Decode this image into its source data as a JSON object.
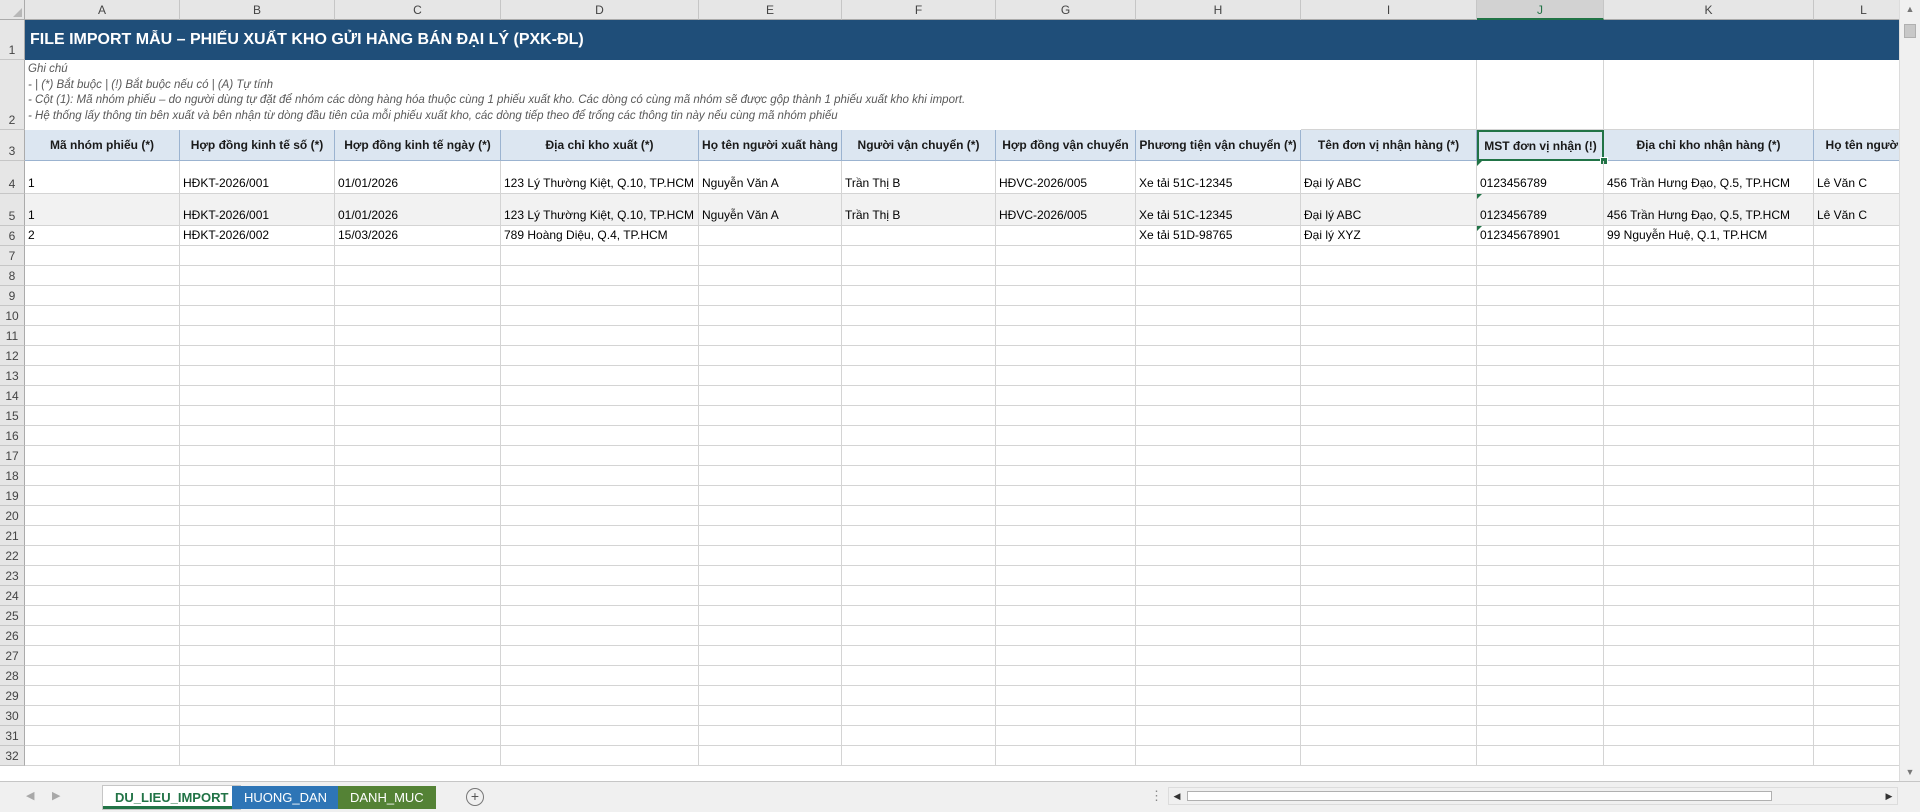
{
  "columns": [
    "A",
    "B",
    "C",
    "D",
    "E",
    "F",
    "G",
    "H",
    "I",
    "J",
    "K",
    "L"
  ],
  "active_column": "J",
  "rows": [
    "1",
    "2",
    "3",
    "4",
    "5",
    "6",
    "7",
    "8",
    "9",
    "10",
    "11",
    "12",
    "13",
    "14",
    "15",
    "16",
    "17",
    "18",
    "19",
    "20",
    "21",
    "22",
    "23",
    "24",
    "25",
    "26",
    "27",
    "28",
    "29",
    "30",
    "31",
    "32"
  ],
  "title": "FILE IMPORT MẪU – PHIẾU XUẤT KHO GỬI HÀNG BÁN ĐẠI LÝ (PXK-ĐL)",
  "notes": [
    "Ghi chú",
    "- |  (*) Bắt buộc  |  (!) Bắt buộc nếu có  |  (A) Tự tính",
    "- Cột (1): Mã nhóm phiếu – do người dùng tự đặt để nhóm các dòng hàng hóa thuộc cùng 1 phiếu xuất kho. Các dòng có cùng mã nhóm sẽ được gộp thành 1 phiếu xuất kho khi import.",
    "- Hệ thống lấy thông tin bên xuất và bên nhận từ dòng đầu tiên của mỗi phiếu xuất kho, các dòng tiếp theo để trống các thông tin này nếu cùng mã nhóm phiếu"
  ],
  "headers": [
    "Mã nhóm phiếu (*)",
    "Hợp đồng kinh tế số (*)",
    "Hợp đồng kinh tế ngày (*)",
    "Địa chỉ kho xuất (*)",
    "Họ tên người xuất hàng",
    "Người vận chuyển (*)",
    "Hợp đồng vận chuyển",
    "Phương tiện vận chuyển (*)",
    "Tên đơn vị nhận hàng (*)",
    "MST đơn vị nhận (!)",
    "Địa chỉ kho nhận hàng (*)",
    "Họ tên người"
  ],
  "data_rows": [
    [
      "1",
      "HĐKT-2026/001",
      "01/01/2026",
      "123 Lý Thường Kiệt, Q.10, TP.HCM",
      "Nguyễn Văn A",
      "Trần Thị B",
      "HĐVC-2026/005",
      "Xe tải 51C-12345",
      "Đại lý ABC",
      "0123456789",
      "456 Trần Hưng Đạo, Q.5, TP.HCM",
      "Lê Văn C"
    ],
    [
      "1",
      "HĐKT-2026/001",
      "01/01/2026",
      "123 Lý Thường Kiệt, Q.10, TP.HCM",
      "Nguyễn Văn A",
      "Trần Thị B",
      "HĐVC-2026/005",
      "Xe tải 51C-12345",
      "Đại lý ABC",
      "0123456789",
      "456 Trần Hưng Đạo, Q.5, TP.HCM",
      "Lê Văn C"
    ],
    [
      "2",
      "HĐKT-2026/002",
      "15/03/2026",
      "789 Hoàng Diệu, Q.4, TP.HCM",
      "",
      "",
      "",
      "Xe tải 51D-98765",
      "Đại lý XYZ",
      "012345678901",
      "99 Nguyễn Huệ, Q.1, TP.HCM",
      ""
    ]
  ],
  "sheet_tabs": [
    {
      "label": "DU_LIEU_IMPORT",
      "style": "active"
    },
    {
      "label": "HUONG_DAN",
      "style": "blue"
    },
    {
      "label": "DANH_MUC",
      "style": "green"
    }
  ],
  "colors": {
    "title_band": "#1f4e79",
    "header_fill": "#dce6f1",
    "excel_green": "#217346",
    "tab_blue": "#2e75b6",
    "tab_green": "#548235"
  },
  "icons": {
    "add_sheet": "plus-circle-icon",
    "scroll_up": "triangle-up-icon",
    "scroll_down": "triangle-down-icon",
    "scroll_left": "triangle-left-icon",
    "scroll_right": "triangle-right-icon"
  }
}
